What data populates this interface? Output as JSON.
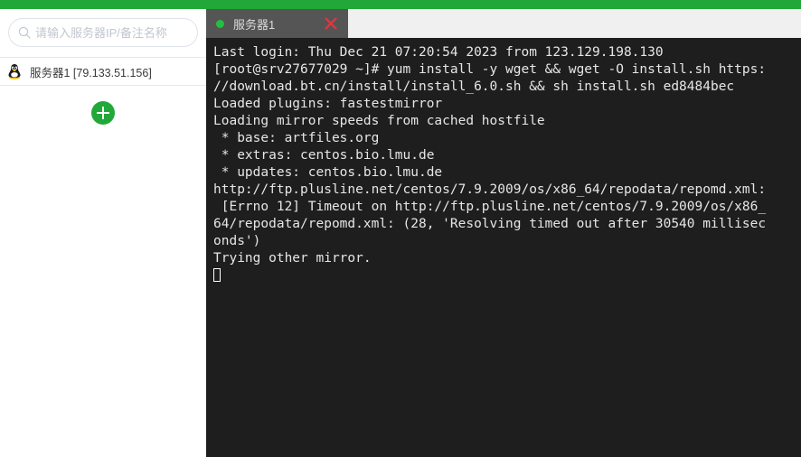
{
  "theme": {
    "accent_green": "#22a839",
    "tab_active_bg": "#555555",
    "terminal_bg": "#1e1e1e",
    "terminal_fg": "#e6e6e6",
    "close_red": "#e8343c",
    "status_dot_green": "#22c040"
  },
  "sidebar": {
    "search": {
      "placeholder": "请输入服务器IP/备注名称",
      "value": "",
      "icon": "search-icon"
    },
    "servers": [
      {
        "icon": "linux-tux-icon",
        "label": "服务器1 [79.133.51.156]"
      }
    ],
    "add_button": {
      "icon": "plus-icon",
      "label": "+"
    }
  },
  "tabs": [
    {
      "label": "服务器1",
      "status_dot": "green-dot-icon",
      "close_icon": "close-icon",
      "active": true
    }
  ],
  "terminal": {
    "lines": [
      "Last login: Thu Dec 21 07:20:54 2023 from 123.129.198.130",
      "[root@srv27677029 ~]# yum install -y wget && wget -O install.sh https:",
      "//download.bt.cn/install/install_6.0.sh && sh install.sh ed8484bec",
      "Loaded plugins: fastestmirror",
      "Loading mirror speeds from cached hostfile",
      " * base: artfiles.org",
      " * extras: centos.bio.lmu.de",
      " * updates: centos.bio.lmu.de",
      "http://ftp.plusline.net/centos/7.9.2009/os/x86_64/repodata/repomd.xml:",
      " [Errno 12] Timeout on http://ftp.plusline.net/centos/7.9.2009/os/x86_",
      "64/repodata/repomd.xml: (28, 'Resolving timed out after 30540 millisec",
      "onds')",
      "Trying other mirror."
    ],
    "cursor": "block-cursor"
  }
}
